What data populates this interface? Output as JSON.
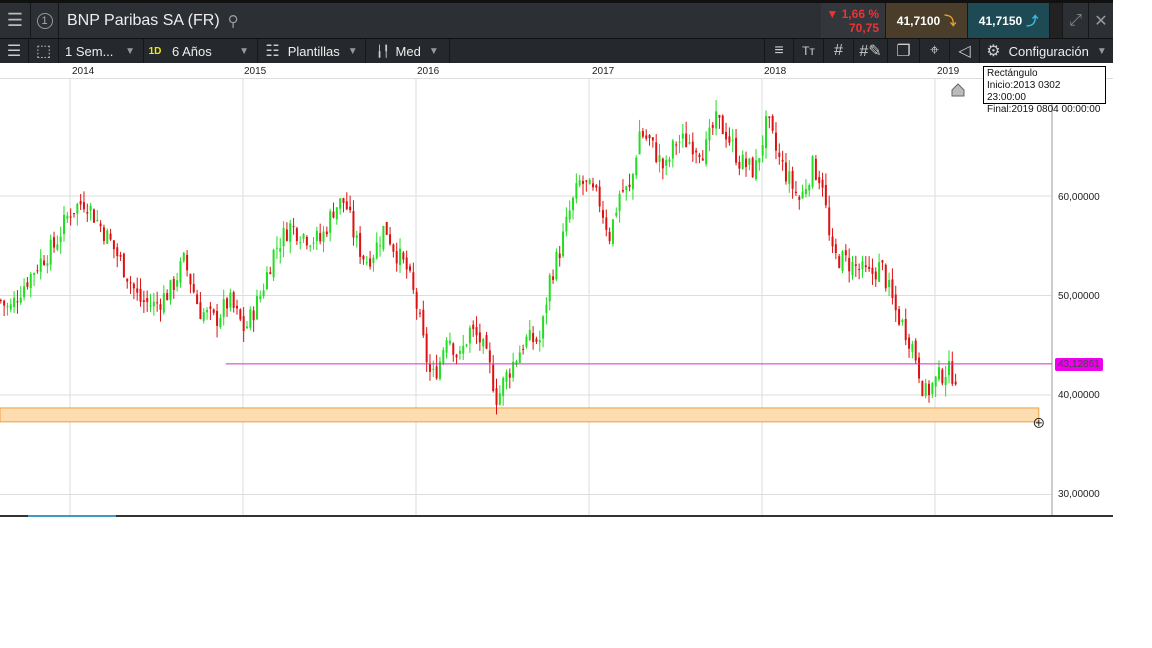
{
  "header": {
    "title": "BNP Paribas SA (FR)",
    "window_number": "1",
    "change_pct": "▼ 1,66 %",
    "change_val": "70,75",
    "sell": "41,7100",
    "buy": "41,7150"
  },
  "toolbar": {
    "interval": "1 Sem...",
    "period_badge": "1D",
    "range": "6 Años",
    "templates": "Plantillas",
    "indicators": "Med",
    "settings": "Configuración"
  },
  "tooltip": {
    "title": "Rectángulo",
    "start": "Inicio:2013 0302 23:00:00",
    "end": "Final:2019 0804 00:00:00"
  },
  "colors": {
    "up": "#22dd22",
    "down": "#dd1111",
    "hline": "#cc33cc",
    "rect_fill": "#fddcb0",
    "rect_border": "#eea040"
  },
  "chart_data": {
    "type": "candlestick",
    "title": "BNP Paribas SA (FR)",
    "x_ticks": [
      "2014",
      "2015",
      "2016",
      "2017",
      "2018",
      "2019"
    ],
    "y_ticks": [
      "30,00000",
      "40,00000",
      "50,00000",
      "60,00000"
    ],
    "y_tick_values": [
      30,
      40,
      50,
      60
    ],
    "ylim": [
      27,
      71
    ],
    "xlim": [
      2013.6,
      2019.72
    ],
    "horizontal_line": {
      "value": 43.12861,
      "label": "43,12861",
      "from": 2014.9
    },
    "rectangle": {
      "low": 37.3,
      "high": 38.7,
      "to": 2019.6
    },
    "closes": [
      [
        2013.6,
        49.5
      ],
      [
        2013.65,
        48.5
      ],
      [
        2013.71,
        50.5
      ],
      [
        2013.83,
        53.5
      ],
      [
        2013.91,
        55
      ],
      [
        2014.0,
        58.5
      ],
      [
        2014.09,
        59.6
      ],
      [
        2014.14,
        58
      ],
      [
        2014.23,
        55.5
      ],
      [
        2014.32,
        52.5
      ],
      [
        2014.4,
        49.5
      ],
      [
        2014.49,
        49
      ],
      [
        2014.58,
        50.5
      ],
      [
        2014.66,
        53.5
      ],
      [
        2014.75,
        48.5
      ],
      [
        2014.84,
        47.5
      ],
      [
        2014.92,
        49.5
      ],
      [
        2015.01,
        46.5
      ],
      [
        2015.1,
        50
      ],
      [
        2015.18,
        54.5
      ],
      [
        2015.27,
        57
      ],
      [
        2015.36,
        56
      ],
      [
        2015.45,
        55.5
      ],
      [
        2015.53,
        59
      ],
      [
        2015.59,
        59.5
      ],
      [
        2015.65,
        55.5
      ],
      [
        2015.71,
        53.5
      ],
      [
        2015.76,
        54.5
      ],
      [
        2015.82,
        57
      ],
      [
        2015.88,
        54.5
      ],
      [
        2015.95,
        52.5
      ],
      [
        2016.01,
        48.5
      ],
      [
        2016.05,
        44.5
      ],
      [
        2016.09,
        41.5
      ],
      [
        2016.14,
        43.5
      ],
      [
        2016.18,
        46.5
      ],
      [
        2016.25,
        43.5
      ],
      [
        2016.31,
        46.5
      ],
      [
        2016.37,
        45.5
      ],
      [
        2016.43,
        42.5
      ],
      [
        2016.47,
        39.5
      ],
      [
        2016.51,
        41.5
      ],
      [
        2016.57,
        43.5
      ],
      [
        2016.63,
        45.5
      ],
      [
        2016.72,
        45.5
      ],
      [
        2016.77,
        51.5
      ],
      [
        2016.83,
        54.5
      ],
      [
        2016.89,
        58.5
      ],
      [
        2016.95,
        61.5
      ],
      [
        2017.01,
        60.5
      ],
      [
        2017.06,
        59.5
      ],
      [
        2017.12,
        56
      ],
      [
        2017.18,
        60.5
      ],
      [
        2017.24,
        60.5
      ],
      [
        2017.29,
        66.5
      ],
      [
        2017.35,
        65.5
      ],
      [
        2017.44,
        62.5
      ],
      [
        2017.5,
        65.5
      ],
      [
        2017.58,
        65.5
      ],
      [
        2017.67,
        64.5
      ],
      [
        2017.73,
        67.5
      ],
      [
        2017.79,
        66.5
      ],
      [
        2017.87,
        63.5
      ],
      [
        2017.96,
        62.5
      ],
      [
        2018.03,
        67.5
      ],
      [
        2018.09,
        64
      ],
      [
        2018.16,
        61.5
      ],
      [
        2018.22,
        59.5
      ],
      [
        2018.29,
        63
      ],
      [
        2018.35,
        61.5
      ],
      [
        2018.4,
        54
      ],
      [
        2018.48,
        53.5
      ],
      [
        2018.57,
        52.5
      ],
      [
        2018.62,
        52
      ],
      [
        2018.69,
        53
      ],
      [
        2018.77,
        48.5
      ],
      [
        2018.83,
        46.5
      ],
      [
        2018.88,
        44.5
      ],
      [
        2018.94,
        40
      ],
      [
        2019.01,
        41.5
      ],
      [
        2019.06,
        42.5
      ],
      [
        2019.12,
        42
      ]
    ]
  }
}
